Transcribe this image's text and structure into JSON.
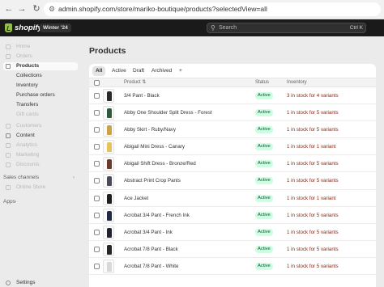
{
  "browser": {
    "url": "admin.shopify.com/store/mariko-boutique/products?selectedView=all"
  },
  "topbar": {
    "logo_text": "shopify",
    "edition": "Winter '24",
    "search_placeholder": "Search",
    "search_shortcut": "Ctrl K"
  },
  "sidebar": {
    "items": [
      {
        "label": "Home"
      },
      {
        "label": "Orders"
      },
      {
        "label": "Products"
      },
      {
        "label": "Collections"
      },
      {
        "label": "Inventory"
      },
      {
        "label": "Purchase orders"
      },
      {
        "label": "Transfers"
      },
      {
        "label": "Gift cards"
      },
      {
        "label": "Customers"
      },
      {
        "label": "Content"
      },
      {
        "label": "Analytics"
      },
      {
        "label": "Marketing"
      },
      {
        "label": "Discounts"
      }
    ],
    "sales_channels_heading": "Sales channels",
    "online_store": "Online Store",
    "apps_heading": "Apps",
    "settings": "Settings"
  },
  "main": {
    "title": "Products",
    "tabs": [
      {
        "label": "All"
      },
      {
        "label": "Active"
      },
      {
        "label": "Draft"
      },
      {
        "label": "Archived"
      },
      {
        "label": "+"
      }
    ],
    "columns": {
      "product": "Product",
      "status": "Status",
      "inventory": "Inventory"
    },
    "rows": [
      {
        "name": "3/4 Pant - Black",
        "status": "Active",
        "inventory": "3 in stock for 4 variants",
        "thumb_color": "#2a2a2a"
      },
      {
        "name": "Abby One Shoulder Split Dress - Forest",
        "status": "Active",
        "inventory": "1 in stock for 5 variants",
        "thumb_color": "#2f5a3c"
      },
      {
        "name": "Abby Skirt - Ruby/Navy",
        "status": "Active",
        "inventory": "1 in stock for 5 variants",
        "thumb_color": "#c9a24a"
      },
      {
        "name": "Abigail Mini Dress - Canary",
        "status": "Active",
        "inventory": "1 in stock for 1 variant",
        "thumb_color": "#e3c35a"
      },
      {
        "name": "Abigail Shift Dress - Bronze/Red",
        "status": "Active",
        "inventory": "1 in stock for 5 variants",
        "thumb_color": "#6b3a2e"
      },
      {
        "name": "Abstract Print Crop Pants",
        "status": "Active",
        "inventory": "1 in stock for 5 variants",
        "thumb_color": "#4a4a5a"
      },
      {
        "name": "Ace Jacket",
        "status": "Active",
        "inventory": "1 in stock for 1 variant",
        "thumb_color": "#1e1e1e"
      },
      {
        "name": "Acrobat 3/4 Pant - French Ink",
        "status": "Active",
        "inventory": "1 in stock for 5 variants",
        "thumb_color": "#1f2a44"
      },
      {
        "name": "Acrobat 3/4 Pant - Ink",
        "status": "Active",
        "inventory": "1 in stock for 5 variants",
        "thumb_color": "#222233"
      },
      {
        "name": "Acrobat 7/8 Pant - Black",
        "status": "Active",
        "inventory": "1 in stock for 5 variants",
        "thumb_color": "#262626"
      },
      {
        "name": "Acrobat 7/8 Pant - White",
        "status": "Active",
        "inventory": "1 in stock for 5 variants",
        "thumb_color": "#d8d8d8"
      }
    ]
  }
}
